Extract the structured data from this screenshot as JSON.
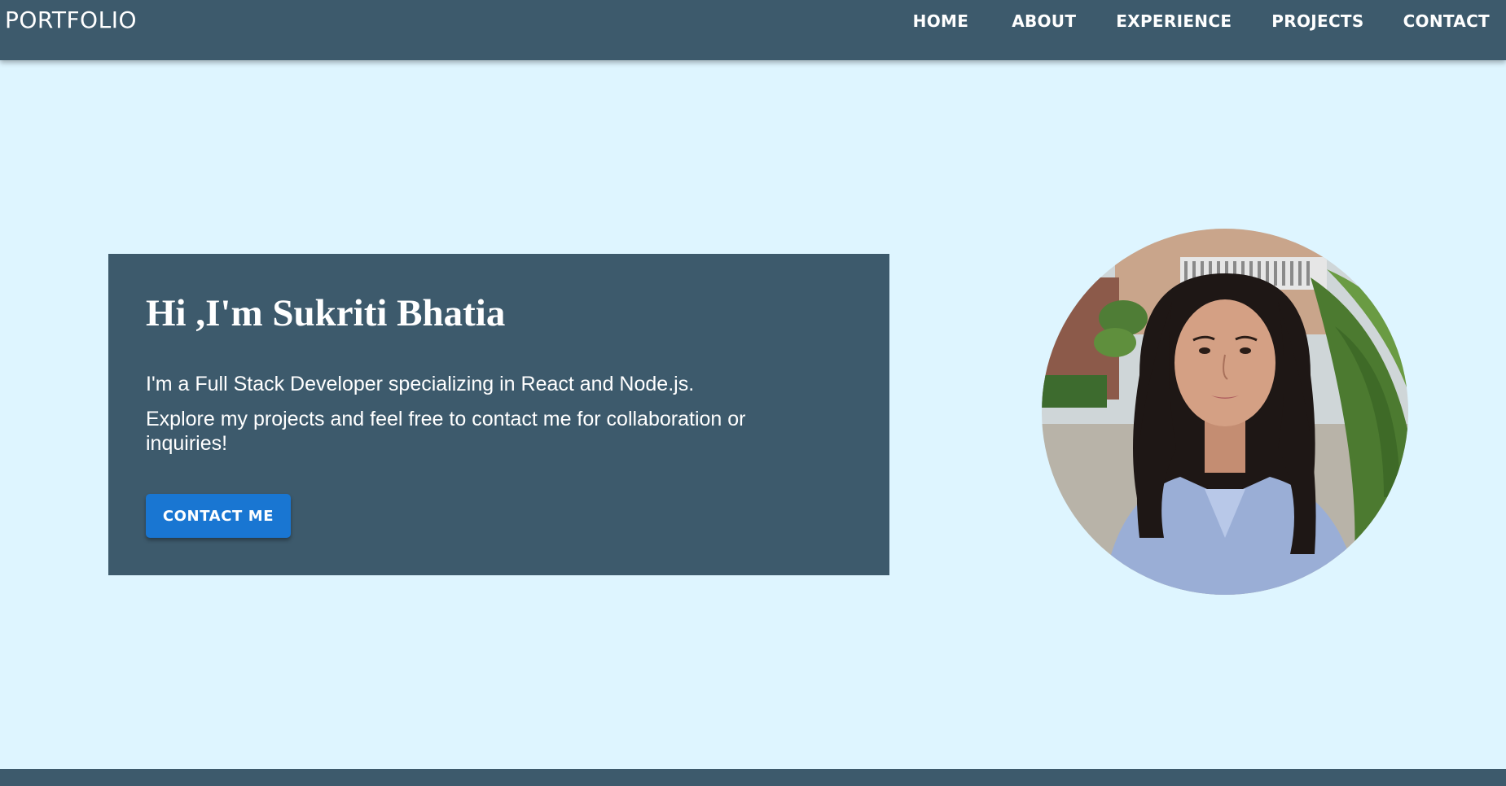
{
  "navbar": {
    "brand": "PORTFOLIO",
    "links": {
      "home": "HOME",
      "about": "ABOUT",
      "experience": "EXPERIENCE",
      "projects": "PROJECTS",
      "contact": "CONTACT"
    }
  },
  "hero": {
    "title": "Hi ,I'm Sukriti Bhatia",
    "line1": "I'm a Full Stack Developer specializing in React and Node.js.",
    "line2": "Explore my projects and feel free to contact me for collaboration or inquiries!",
    "cta_label": "CONTACT ME"
  },
  "profile_photo": {
    "icon": "avatar-photo"
  },
  "colors": {
    "page_background": "#def5ff",
    "navbar_background": "#3d5a6c",
    "card_background": "#3d5a6c",
    "button_background": "#1976d2",
    "text": "#ffffff"
  }
}
